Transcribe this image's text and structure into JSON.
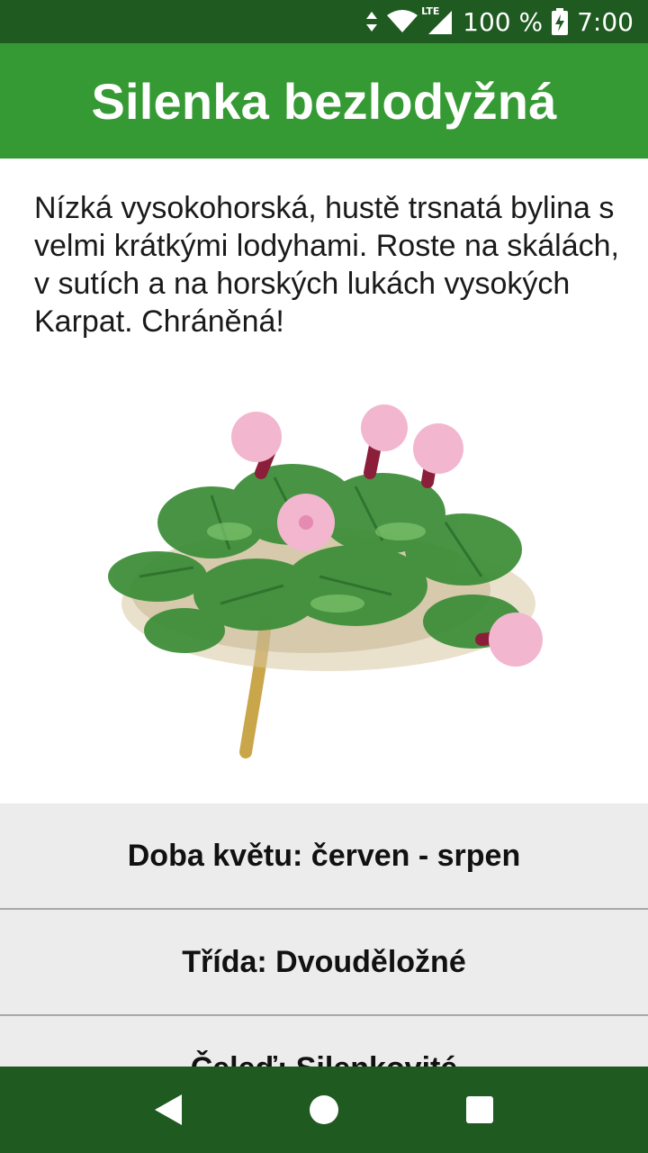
{
  "status_bar": {
    "network_type": "LTE",
    "battery_percent": "100 %",
    "time": "7:00",
    "icons": [
      "data-arrows-icon",
      "wifi-icon",
      "cell-signal-icon",
      "battery-charging-icon"
    ]
  },
  "app_bar": {
    "title": "Silenka bezlodyžná",
    "color": "#359a33"
  },
  "description": "Nízká vysokohorská, hustě trsnatá bylina s velmi krátkými lodyhami. Roste na skálách, v sutích a na horských lukách vysokých Karpat. Chráněná!",
  "image": {
    "subject": "silene-acaulis-plant-illustration"
  },
  "info": [
    {
      "text": "Doba květu: červen - srpen"
    },
    {
      "text": "Třída: Dvouděložné"
    },
    {
      "text": "Čeleď: Silenkovité"
    }
  ],
  "nav_bar": {
    "icons": [
      "back-icon",
      "home-icon",
      "recents-icon"
    ],
    "color": "#1f5a20"
  }
}
